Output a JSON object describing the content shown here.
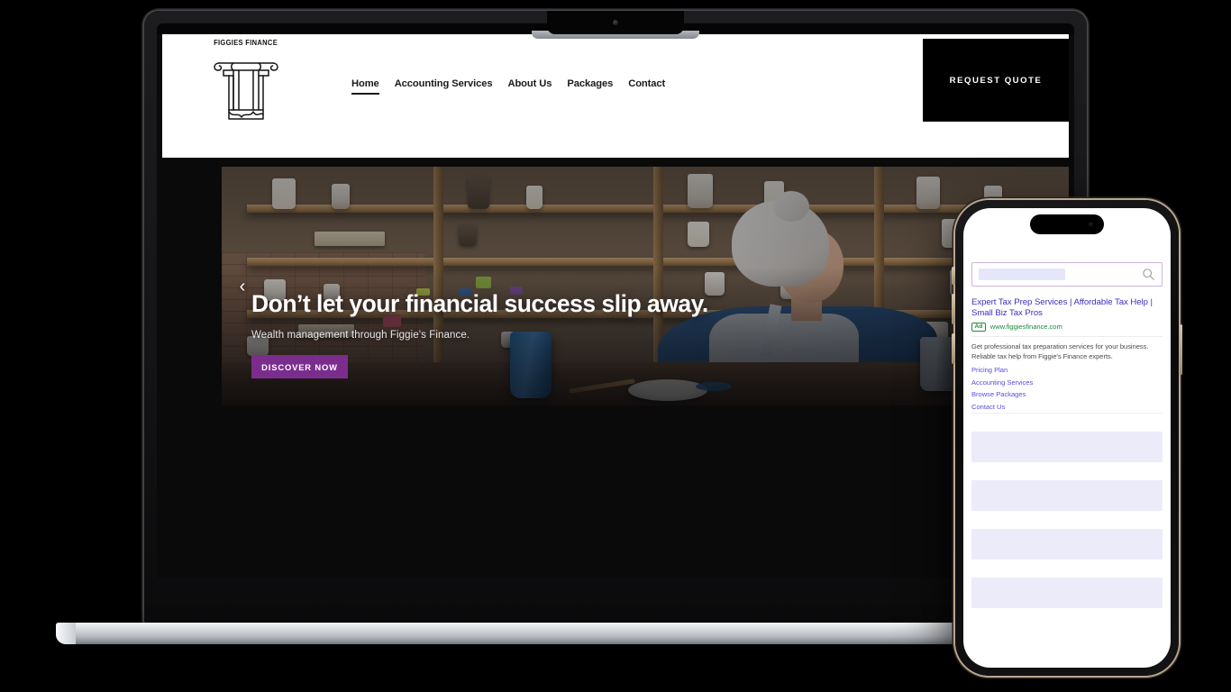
{
  "device_mockup": {
    "laptop": {
      "frame_color": "#1d1d1f",
      "base_color": "#d9dbdf"
    },
    "phone": {
      "frame_color": "#0a0a0b",
      "accent_edge": "#b8a68f"
    }
  },
  "website": {
    "brand": {
      "name": "FIGGIES FINANCE",
      "logo_icon": "greek-column-icon"
    },
    "nav": {
      "items": [
        {
          "label": "Home",
          "active": true
        },
        {
          "label": "Accounting Services",
          "active": false
        },
        {
          "label": "About Us",
          "active": false
        },
        {
          "label": "Packages",
          "active": false
        },
        {
          "label": "Contact",
          "active": false
        }
      ]
    },
    "cta": {
      "label": "REQUEST QUOTE",
      "background": "#000000",
      "color": "#ffffff"
    },
    "hero": {
      "title": "Don’t let your financial success slip away.",
      "subtitle": "Wealth management through Figgie's Finance.",
      "button_label": "DISCOVER NOW",
      "button_color": "#7b2d8e",
      "prev_arrow": "‹",
      "image_alt": "Woman working in a pottery studio"
    }
  },
  "phone_serp": {
    "search": {
      "value": "",
      "placeholder": "",
      "icon": "search-icon"
    },
    "ad": {
      "title": "Expert Tax Prep Services | Affordable Tax Help | Small Biz Tax Pros",
      "badge": "Ad",
      "url": "www.figgiesfinance.com",
      "description": "Get professional tax preparation services for your business. Reliable tax help from Figgie's Finance experts.",
      "sitelinks": [
        {
          "label": "Pricing Plan"
        },
        {
          "label": "Accounting Services"
        },
        {
          "label": "Browse Packages"
        },
        {
          "label": "Contact Us"
        }
      ],
      "link_color": "#3b2fbf",
      "url_color": "#1e8a3c"
    },
    "placeholder_blocks": [
      1,
      2,
      3,
      4
    ]
  }
}
